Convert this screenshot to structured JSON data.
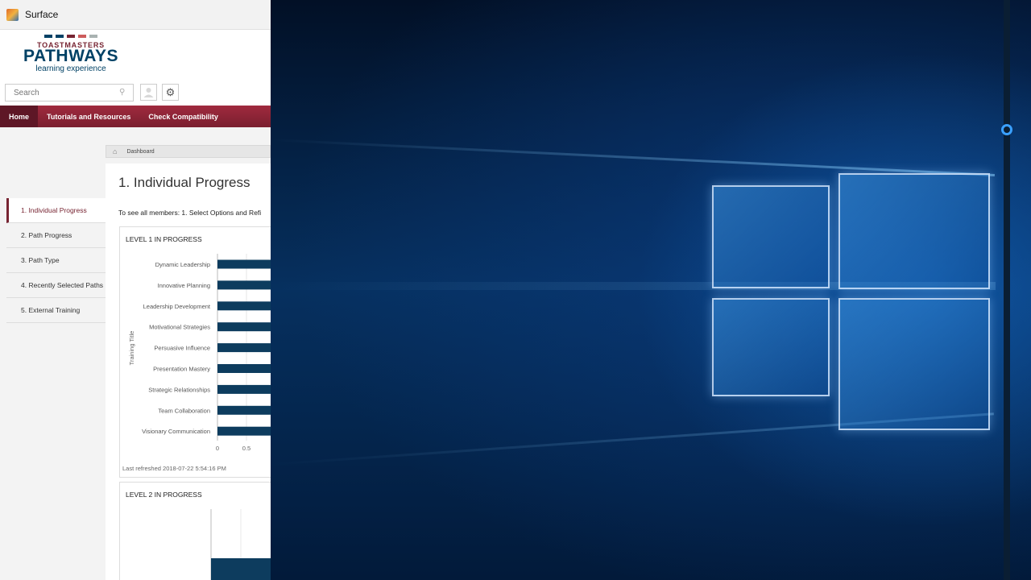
{
  "window": {
    "title": "Surface"
  },
  "logo": {
    "bar_colors": [
      "#004165",
      "#004165",
      "#772432",
      "#cd5c5c",
      "#a9b2b1"
    ],
    "top": "TOASTMASTERS",
    "main": "PATHWAYS",
    "sub": "learning experience"
  },
  "search": {
    "placeholder": "Search",
    "icon": "search-icon"
  },
  "nav": {
    "items": [
      "Home",
      "Tutorials and Resources",
      "Check Compatibility"
    ]
  },
  "breadcrumb": {
    "label": "Dashboard"
  },
  "sidebar": {
    "items": [
      "1. Individual Progress",
      "2. Path Progress",
      "3. Path Type",
      "4. Recently Selected Paths",
      "5. External Training"
    ]
  },
  "main": {
    "title": "1. Individual Progress",
    "instructions": "To see all members: 1. Select Options and Refi"
  },
  "level1": {
    "title": "LEVEL 1 IN PROGRESS",
    "refreshed": "Last refreshed 2018-07-22 5:54:16 PM"
  },
  "level2": {
    "title": "LEVEL 2 IN PROGRESS"
  },
  "chart_data": [
    {
      "type": "bar",
      "orientation": "horizontal",
      "title": "LEVEL 1 IN PROGRESS",
      "ylabel": "Training Title",
      "categories": [
        "Dynamic Leadership",
        "Innovative Planning",
        "Leadership Development",
        "Motivational Strategies",
        "Persuasive Influence",
        "Presentation Mastery",
        "Strategic Relationships",
        "Team Collaboration",
        "Visionary Communication"
      ],
      "x_ticks": [
        "0",
        "0.5"
      ],
      "bar_color": "#0d3c5e",
      "grid": true
    }
  ],
  "colors": {
    "brand_maroon": "#772432",
    "brand_blue": "#004165",
    "accent_blue": "#3aa0ff"
  }
}
